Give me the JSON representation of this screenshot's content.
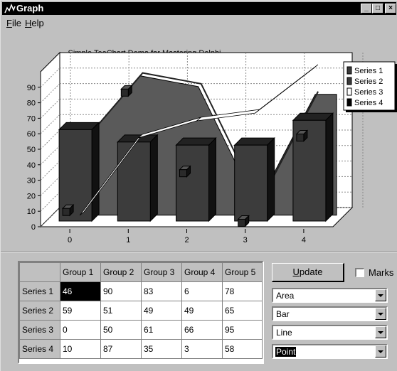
{
  "window": {
    "title": "Graph",
    "buttons": {
      "minimize": "_",
      "maximize": "□",
      "close": "×"
    }
  },
  "menu": [
    {
      "label": "File",
      "mnemonic": "F",
      "rest": "ile"
    },
    {
      "label": "Help",
      "mnemonic": "H",
      "rest": "elp"
    }
  ],
  "chart_data": {
    "type": "bar",
    "title": "Simple TeeChart Demo for Mastering Delphi",
    "xlabel": "",
    "ylabel": "",
    "ylim": [
      0,
      100
    ],
    "y_ticks": [
      0,
      10,
      20,
      30,
      40,
      50,
      60,
      70,
      80,
      90
    ],
    "x_ticks": [
      "0",
      "1",
      "2",
      "3",
      "4"
    ],
    "grid": true,
    "view": "3D",
    "legend_position": "right",
    "series": [
      {
        "name": "Series 1",
        "kind": "area",
        "values": [
          46,
          90,
          83,
          6,
          78
        ]
      },
      {
        "name": "Series 2",
        "kind": "bar",
        "values": [
          59,
          51,
          49,
          49,
          65
        ]
      },
      {
        "name": "Series 3",
        "kind": "line",
        "values": [
          0,
          50,
          61,
          66,
          95
        ]
      },
      {
        "name": "Series 4",
        "kind": "point",
        "values": [
          10,
          87,
          35,
          3,
          58
        ]
      }
    ]
  },
  "colors": {
    "area": "#5a5a5a",
    "bar": "#3c3c3c",
    "line": "#ffffff",
    "point": "#2a2a2a",
    "back_wall": "#ffffff",
    "panel": "#c0c0c0"
  },
  "grid": {
    "columns": [
      "Group 1",
      "Group 2",
      "Group 3",
      "Group 4",
      "Group 5"
    ],
    "rows": [
      {
        "label": "Series 1",
        "values": [
          "46",
          "90",
          "83",
          "6",
          "78"
        ]
      },
      {
        "label": "Series 2",
        "values": [
          "59",
          "51",
          "49",
          "49",
          "65"
        ]
      },
      {
        "label": "Series 3",
        "values": [
          "0",
          "50",
          "61",
          "66",
          "95"
        ]
      },
      {
        "label": "Series 4",
        "values": [
          "10",
          "87",
          "35",
          "3",
          "58"
        ]
      }
    ]
  },
  "controls": {
    "update_button": {
      "mnemonic": "U",
      "rest": "pdate"
    },
    "marks_checkbox": {
      "label": "Marks",
      "checked": false
    },
    "series_types": [
      "Area",
      "Bar",
      "Line",
      "Point"
    ],
    "selected_combo": 3
  }
}
